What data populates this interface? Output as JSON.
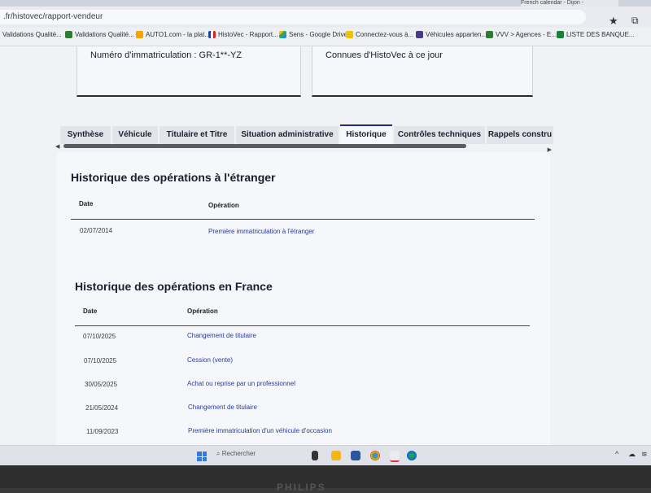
{
  "browser": {
    "tab_title": "French calendar - Dijon -",
    "url": ".fr/histovec/rapport-vendeur",
    "bookmarks": [
      {
        "label": "Validations Qualité...",
        "icon": "bookmark-icon",
        "color": "#e7eaf0"
      },
      {
        "label": "Validations Qualité...",
        "icon": "green-folder-icon",
        "color": "#2e7d32"
      },
      {
        "label": "AUTO1.com - la plat...",
        "icon": "auto1-icon",
        "color": "#f4a300"
      },
      {
        "label": "HistoVec - Rapport...",
        "icon": "french-flag-icon",
        "color": "#1f3fa0"
      },
      {
        "label": "Sens - Google Drive",
        "icon": "google-drive-icon",
        "color": "#1e88e5"
      },
      {
        "label": "Connectez-vous à...",
        "icon": "yellow-site-icon",
        "color": "#f2c200"
      },
      {
        "label": "Véhicules apparten...",
        "icon": "purple-site-icon",
        "color": "#4b3a8a"
      },
      {
        "label": "VVV > Agences - E...",
        "icon": "green-folder-icon",
        "color": "#2e7d32"
      },
      {
        "label": "LISTE DES BANQUE...",
        "icon": "green-sheet-icon",
        "color": "#188038"
      }
    ]
  },
  "cards": {
    "immatriculation": "Numéro d'immatriculation : GR-1**-YZ",
    "connues": "Connues d'HistoVec à ce jour"
  },
  "tabs": [
    "Synthèse",
    "Véhicule",
    "Titulaire et Titre",
    "Situation administrative",
    "Historique",
    "Contrôles techniques",
    "Rappels constru"
  ],
  "active_tab": "Historique",
  "etranger": {
    "title": "Historique des opérations à l'étranger",
    "col_date": "Date",
    "col_operation": "Opération",
    "rows": [
      {
        "date": "02/07/2014",
        "operation": "Première immatriculation à l'étranger"
      }
    ]
  },
  "france": {
    "title": "Historique des opérations en France",
    "col_date": "Date",
    "col_operation": "Opération",
    "rows": [
      {
        "date": "07/10/2025",
        "operation": "Changement de titulaire"
      },
      {
        "date": "07/10/2025",
        "operation": "Cession (vente)"
      },
      {
        "date": "30/05/2025",
        "operation": "Achat ou reprise par un professionnel"
      },
      {
        "date": "21/05/2024",
        "operation": "Changement de titulaire"
      },
      {
        "date": "11/09/2023",
        "operation": "Première immatriculation d'un véhicule d'occasion"
      }
    ]
  },
  "taskbar": {
    "search_placeholder": "Rechercher",
    "monitor_brand": "PHILIPS"
  }
}
